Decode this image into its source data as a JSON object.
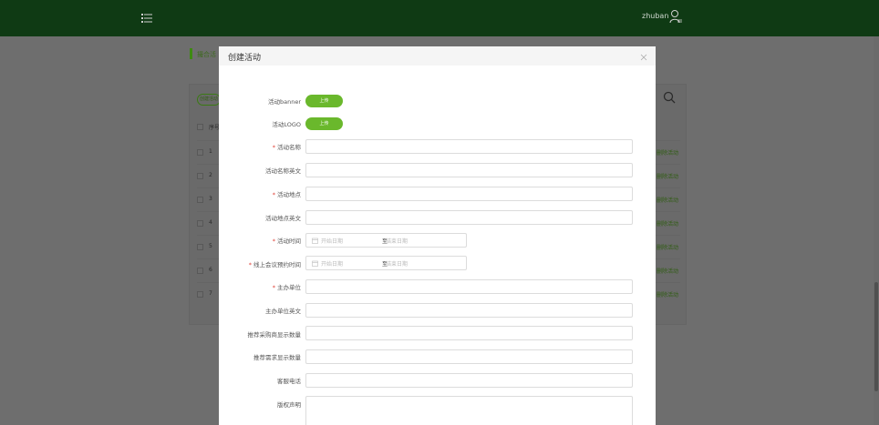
{
  "header": {
    "username": "zhuban",
    "menu_icon": "menu-list-icon",
    "user_icon": "user-settings-icon"
  },
  "background_page": {
    "breadcrumb": "撮合活",
    "create_button": "创建活动",
    "search_icon": "search-icon",
    "table": {
      "header_label": "序号",
      "rows": [
        {
          "num": "1",
          "action": "删除活动"
        },
        {
          "num": "2",
          "action": "删除活动"
        },
        {
          "num": "3",
          "action": "删除活动"
        },
        {
          "num": "4",
          "action": "删除活动"
        },
        {
          "num": "5",
          "action": "删除活动"
        },
        {
          "num": "6",
          "action": "删除活动"
        },
        {
          "num": "7",
          "action": "删除活动"
        }
      ]
    }
  },
  "modal": {
    "title": "创建活动",
    "close_icon": "close-icon",
    "fields": {
      "banner_label": "活动banner",
      "banner_button": "上传",
      "logo_label": "活动LOGO",
      "logo_button": "上传",
      "name_label": "活动名称",
      "name_en_label": "活动名称英文",
      "location_label": "活动地点",
      "location_en_label": "活动地点英文",
      "time_label": "活动时间",
      "time_start_placeholder": "开始日期",
      "time_separator": "至",
      "time_end_placeholder": "结束日期",
      "meeting_time_label": "线上会议预约时间",
      "meeting_start_placeholder": "开始日期",
      "meeting_separator": "至",
      "meeting_end_placeholder": "结束日期",
      "organizer_label": "主办单位",
      "organizer_en_label": "主办单位英文",
      "buyer_count_label": "推荐采购商显示数量",
      "demand_count_label": "推荐需求显示数量",
      "service_phone_label": "客服电话",
      "copyright_label": "版权声明"
    },
    "required_mark": "*"
  },
  "colors": {
    "accent_green": "#6ab82c",
    "header_bg": "#0f3a14",
    "required_red": "#e0443a"
  }
}
